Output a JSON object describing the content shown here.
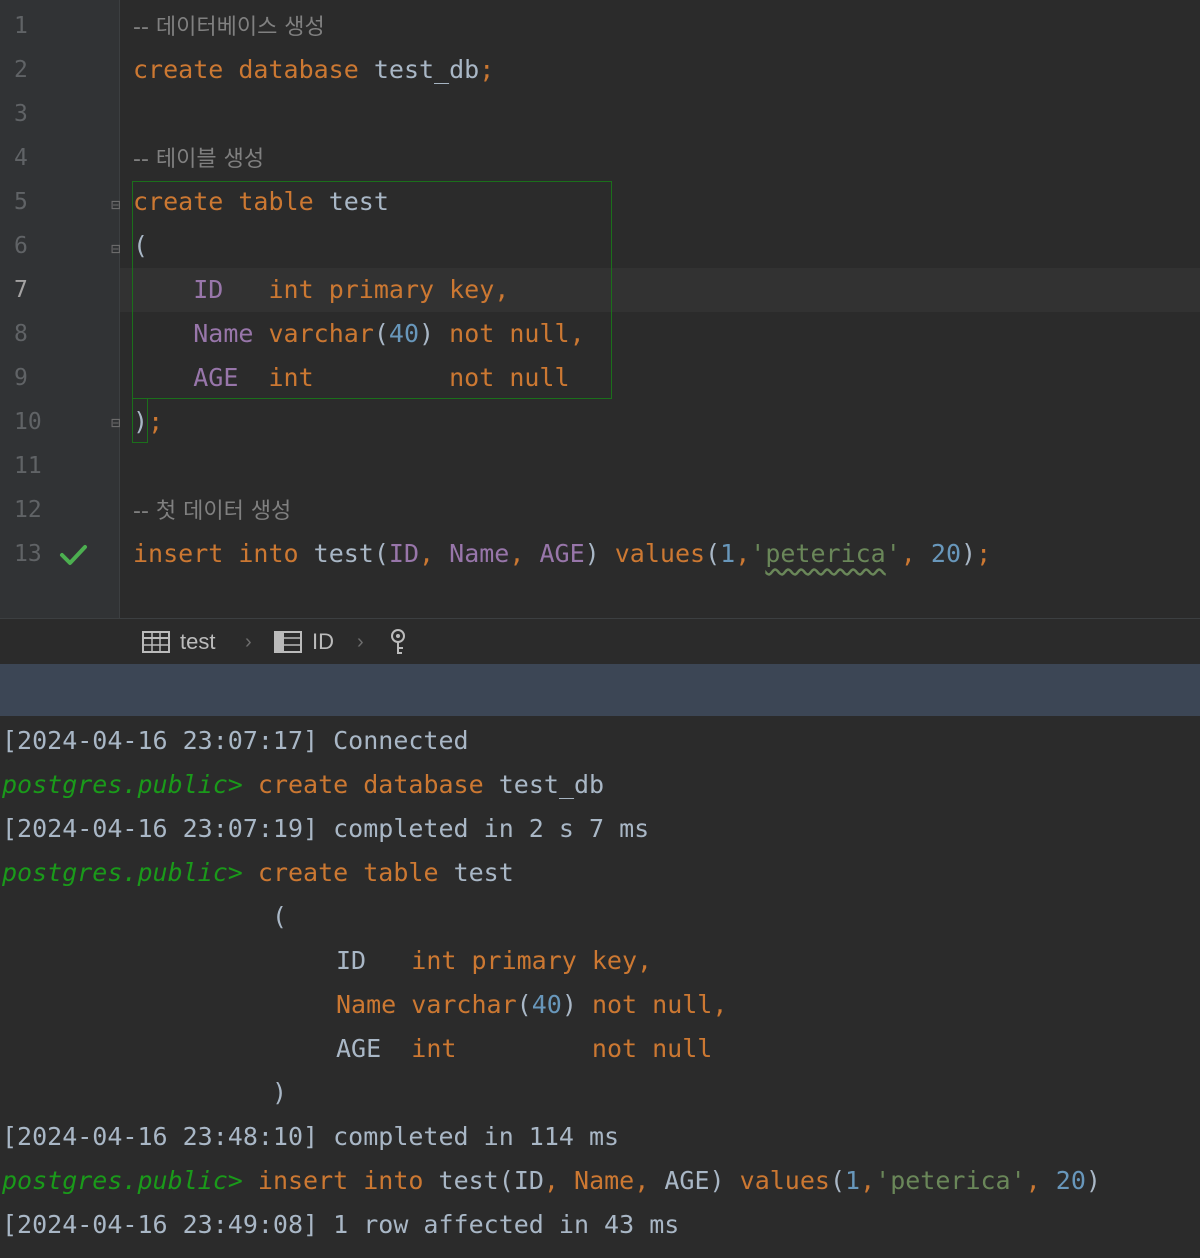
{
  "editor": {
    "line_numbers": [
      "1",
      "2",
      "3",
      "4",
      "5",
      "6",
      "7",
      "8",
      "9",
      "10",
      "11",
      "12",
      "13"
    ],
    "current_line": "7",
    "lines": {
      "l1_comment": "-- 데이터베이스 생성",
      "l2_kw": "create database",
      "l2_name": "test_db",
      "l2_semi": ";",
      "l4_comment": "-- 테이블 생성",
      "l5_kw": "create table",
      "l5_name": "test",
      "l6_paren": "(",
      "l7_col": "ID",
      "l7_type": "int primary key,",
      "l8_col": "Name",
      "l8_type": "varchar",
      "l8_open": "(",
      "l8_num": "40",
      "l8_close": ")",
      "l8_rest": "not null,",
      "l9_col": "AGE",
      "l9_type": "int",
      "l9_rest": "not null",
      "l10_close": ")",
      "l10_semi": ";",
      "l12_comment": "-- 첫 데이터 생성",
      "l13_kw1": "insert into",
      "l13_name": "test",
      "l13_open": "(",
      "l13_c1": "ID",
      "l13_comma1": ", ",
      "l13_c2": "Name",
      "l13_comma2": ", ",
      "l13_c3": "AGE",
      "l13_close": ")",
      "l13_values": "values",
      "l13_vopen": "(",
      "l13_n1": "1",
      "l13_comma3": ",",
      "l13_q1": "'",
      "l13_str": "peterica",
      "l13_q2": "'",
      "l13_comma4": ", ",
      "l13_n2": "20",
      "l13_vclose": ")",
      "l13_semi": ";"
    }
  },
  "breadcrumb": {
    "table": "test",
    "column": "ID"
  },
  "console": {
    "c1": "[2024-04-16 23:07:17] Connected",
    "prompt": "postgres.public>",
    "c2_kw": "create database",
    "c2_name": "test_db",
    "c3": "[2024-04-16 23:07:19] completed in 2 s 7 ms",
    "c4_kw": "create table",
    "c4_name": "test",
    "c5_paren": "(",
    "c6_col": "ID",
    "c6_type": "int primary key,",
    "c7_col": "Name",
    "c7_type": "varchar",
    "c7_open": "(",
    "c7_num": "40",
    "c7_close": ")",
    "c7_rest": "not null,",
    "c8_col": "AGE",
    "c8_type": "int",
    "c8_rest": "not null",
    "c9_paren": ")",
    "c10": "[2024-04-16 23:48:10] completed in 114 ms",
    "c11_kw1": "insert into",
    "c11_name": "test",
    "c11_open": "(",
    "c11_c1": "ID",
    "c11_comma1": ", ",
    "c11_c2": "Name",
    "c11_comma2": ", ",
    "c11_c3": "AGE",
    "c11_close": ")",
    "c11_values": "values",
    "c11_vopen": "(",
    "c11_n1": "1",
    "c11_comma3": ",",
    "c11_str": "'peterica'",
    "c11_comma4": ", ",
    "c11_n2": "20",
    "c11_vclose": ")",
    "c12": "[2024-04-16 23:49:08] 1 row affected in 43 ms"
  },
  "icons": {
    "check": "check-icon",
    "table": "table-icon",
    "column": "column-icon",
    "key": "key-icon"
  },
  "colors": {
    "keyword": "#cc7832",
    "column": "#9876aa",
    "number": "#6897bb",
    "string": "#6a8759",
    "comment": "#808080",
    "prompt": "#1a9a1a",
    "success": "#4caf50"
  }
}
